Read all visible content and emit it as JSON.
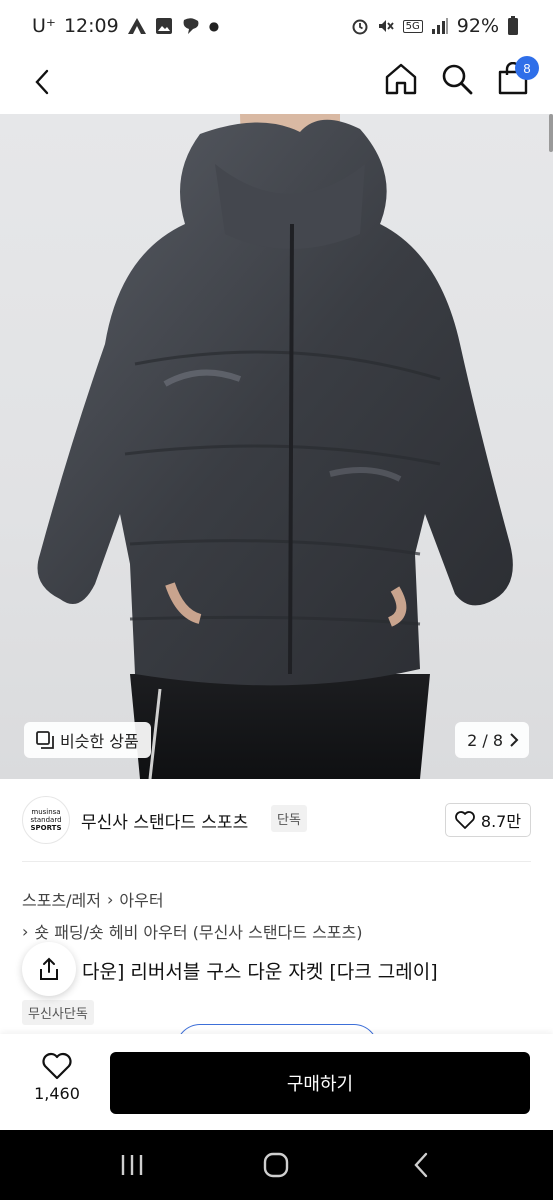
{
  "status_bar": {
    "carrier": "U⁺",
    "time": "12:09",
    "network": "5G",
    "battery": "92%"
  },
  "top_bar": {
    "cart_count": "8"
  },
  "gallery": {
    "similar_label": "비슷한 상품",
    "counter": "2 / 8"
  },
  "brand": {
    "logo_line1": "musinsa",
    "logo_line2": "standard",
    "logo_line3": "SPORTS",
    "name": "무신사 스탠다드 스포츠",
    "tag": "단독",
    "likes": "8.7만"
  },
  "category": {
    "main": "스포츠/레저",
    "sub": "아우터",
    "detail": "숏 패딩/숏 헤비 아우터 (무신사 스탠다드 스포츠)"
  },
  "product": {
    "title_visible": "다운] 리버서블 구스 다운 자켓 [다크 그레이]",
    "exclusive_tag": "무신사단독"
  },
  "bottom": {
    "wish_count": "1,460",
    "buy_label": "구매하기"
  },
  "colors": {
    "accent": "#2f6fe9",
    "jacket": "#3c3f45"
  }
}
